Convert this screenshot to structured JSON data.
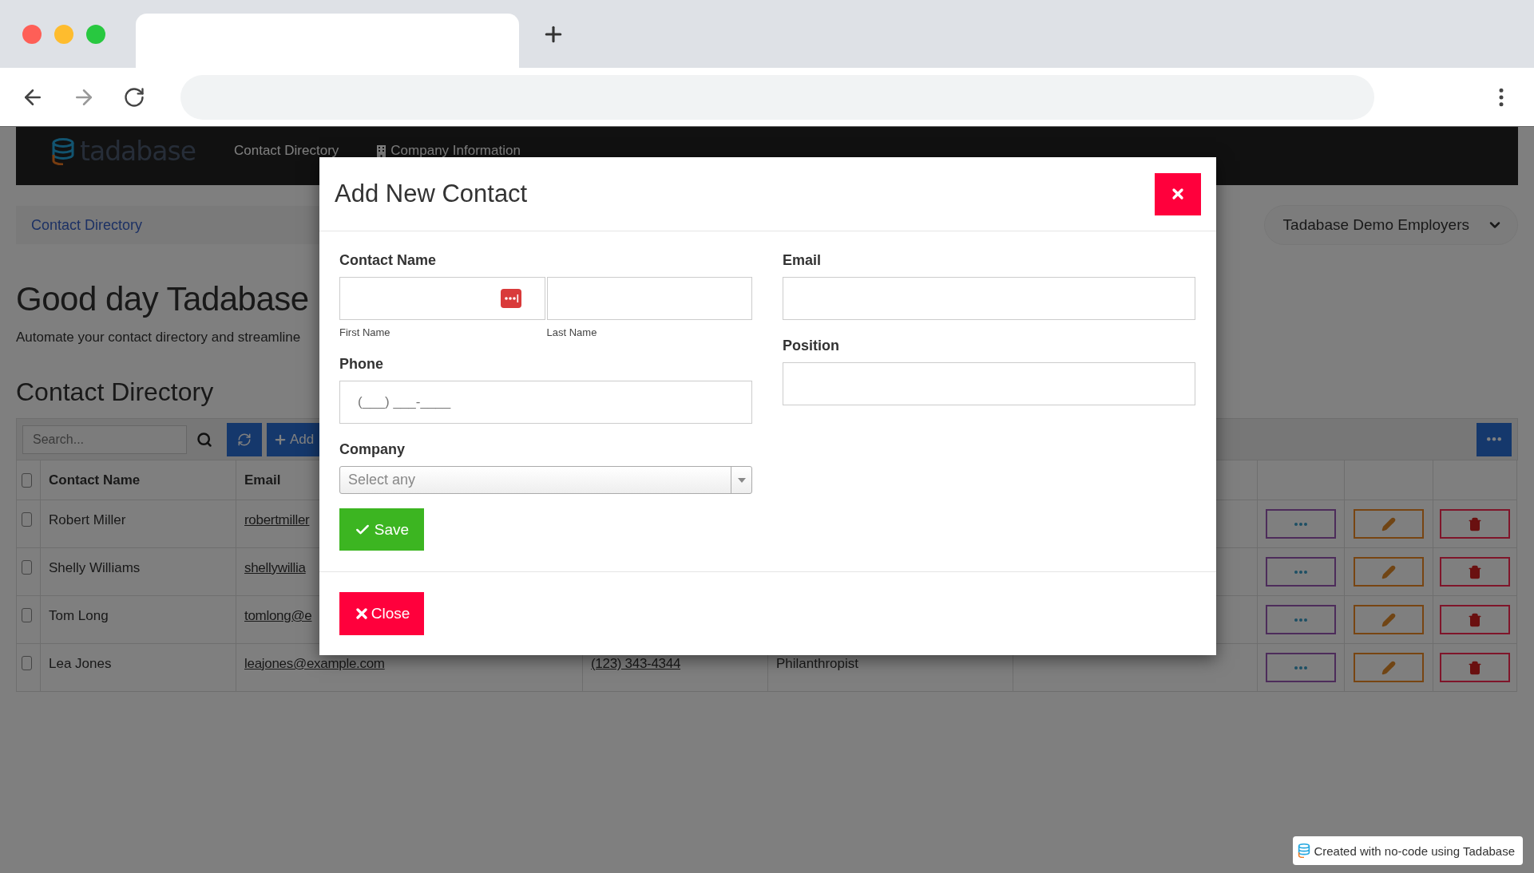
{
  "nav": {
    "logo_text": "tadabase",
    "items": [
      {
        "label": "Contact Directory",
        "kind": "plain"
      },
      {
        "label": "Company Information",
        "kind": "icon"
      }
    ]
  },
  "breadcrumb": "Contact Directory",
  "app_switcher": "Tadabase Demo Employers",
  "greeting": "Good day Tadabase",
  "intro": "Automate your contact directory and streamline",
  "section_title": "Contact Directory",
  "toolbar": {
    "search_placeholder": "Search...",
    "add_label": "Add"
  },
  "table": {
    "select_all_checked": false,
    "columns": [
      "Contact Name",
      "Email"
    ],
    "rows": [
      {
        "checked": false,
        "name": "Robert Miller",
        "email": "robertmiller"
      },
      {
        "checked": false,
        "name": "Shelly Williams",
        "email": "shellywillia"
      },
      {
        "checked": false,
        "name": "Tom Long",
        "email": "tomlong@e"
      },
      {
        "checked": false,
        "name": "Lea Jones",
        "email": "leajones@example.com",
        "phone": "(123) 343-4344",
        "position": "Philanthropist"
      }
    ]
  },
  "modal": {
    "title": "Add New Contact",
    "left_fields": [
      {
        "kind": "name",
        "label": "Contact Name",
        "sublabels": [
          "First Name",
          "Last Name"
        ]
      },
      {
        "kind": "text",
        "label": "Phone",
        "placeholder": "(___) ___-____"
      },
      {
        "kind": "select",
        "label": "Company",
        "placeholder": "Select any"
      }
    ],
    "right_fields": [
      {
        "kind": "text",
        "label": "Email"
      },
      {
        "kind": "text",
        "label": "Position"
      }
    ],
    "save_label": "Save",
    "close_label": "Close"
  },
  "badge": "Created with no-code using Tadabase"
}
